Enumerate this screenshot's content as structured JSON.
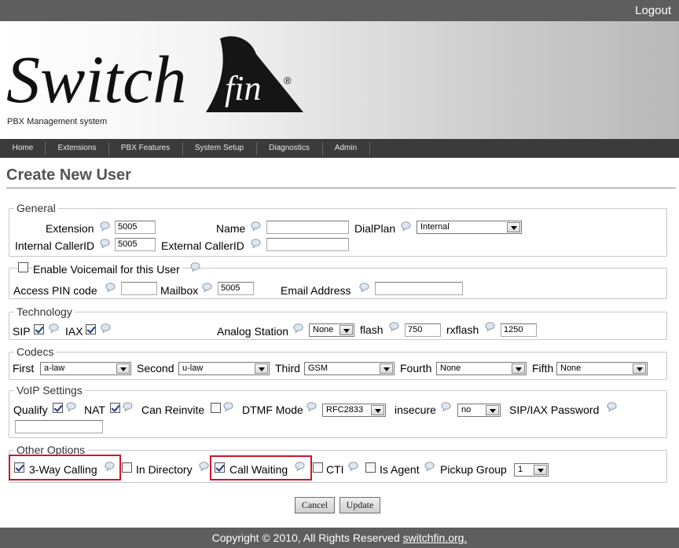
{
  "topbar": {
    "logout": "Logout"
  },
  "header": {
    "logo_text": "Switch",
    "logo_fin": "fin",
    "tagline": "PBX Management system"
  },
  "nav": [
    "Home",
    "Extensions",
    "PBX Features",
    "System Setup",
    "Diagnostics",
    "Admin"
  ],
  "page": {
    "title": "Create New User"
  },
  "general": {
    "legend": "General",
    "extension_label": "Extension",
    "extension_value": "5005",
    "name_label": "Name",
    "name_value": "",
    "dialplan_label": "DialPlan",
    "dialplan_value": "Internal",
    "internal_callerid_label": "Internal CallerID",
    "internal_callerid_value": "5005",
    "external_callerid_label": "External CallerID",
    "external_callerid_value": ""
  },
  "voicemail": {
    "enable_label": "Enable Voicemail for this User",
    "enabled": false,
    "pin_label": "Access PIN code",
    "pin_value": "",
    "mailbox_label": "Mailbox",
    "mailbox_value": "5005",
    "email_label": "Email Address",
    "email_value": ""
  },
  "technology": {
    "legend": "Technology",
    "sip_label": "SIP",
    "sip_checked": true,
    "iax_label": "IAX",
    "iax_checked": true,
    "analog_label": "Analog Station",
    "analog_value": "None",
    "flash_label": "flash",
    "flash_value": "750",
    "rxflash_label": "rxflash",
    "rxflash_value": "1250"
  },
  "codecs": {
    "legend": "Codecs",
    "first_label": "First",
    "first_value": "a-law",
    "second_label": "Second",
    "second_value": "u-law",
    "third_label": "Third",
    "third_value": "GSM",
    "fourth_label": "Fourth",
    "fourth_value": "None",
    "fifth_label": "Fifth",
    "fifth_value": "None"
  },
  "voip": {
    "legend": "VoIP Settings",
    "qualify_label": "Qualify",
    "qualify_checked": true,
    "nat_label": "NAT",
    "nat_checked": true,
    "reinvite_label": "Can Reinvite",
    "reinvite_checked": false,
    "dtmf_label": "DTMF Mode",
    "dtmf_value": "RFC2833",
    "insecure_label": "insecure",
    "insecure_value": "no",
    "password_label": "SIP/IAX Password",
    "password_value": ""
  },
  "other": {
    "legend": "Other Options",
    "threeway_label": "3-Way Calling",
    "threeway_checked": true,
    "directory_label": "In Directory",
    "directory_checked": false,
    "callwaiting_label": "Call Waiting",
    "callwaiting_checked": true,
    "cti_label": "CTI",
    "cti_checked": false,
    "agent_label": "Is Agent",
    "agent_checked": false,
    "pickup_label": "Pickup Group",
    "pickup_value": "1"
  },
  "buttons": {
    "cancel": "Cancel",
    "update": "Update"
  },
  "footer": {
    "copyright": "Copyright © 2010, All Rights Reserved",
    "link": "switchfin.org."
  },
  "colors": {
    "highlight": "#d0142c",
    "nav_bg": "#3b3b3b",
    "bar_bg": "#5e5e5e"
  }
}
